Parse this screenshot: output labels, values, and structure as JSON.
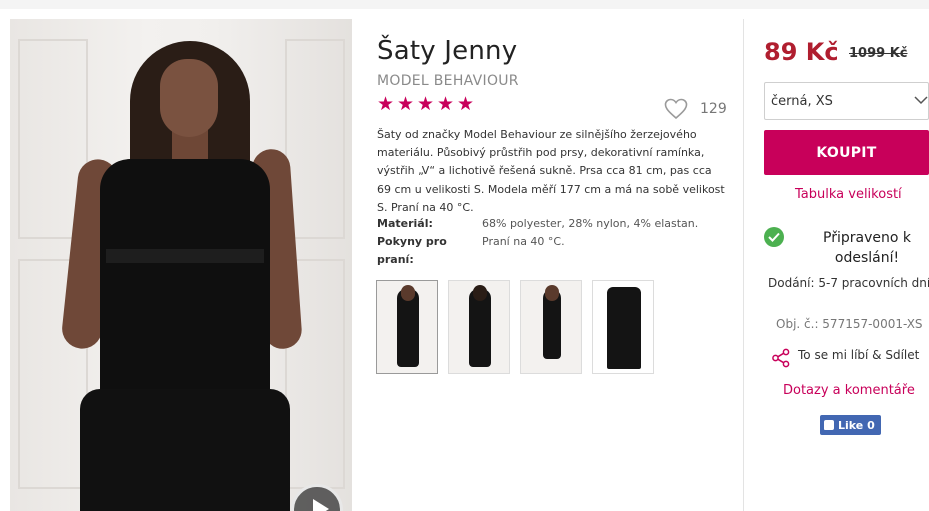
{
  "product": {
    "title": "Šaty Jenny",
    "brand": "MODEL BEHAVIOUR",
    "rating_stars": 5,
    "likes_count": "129",
    "description": "Šaty od značky Model Behaviour ze silnějšího žerzejového materiálu. Působivý průstřih pod prsy, dekorativní ramínka, výstřih „V“ a lichotivě řešená sukně. Prsa cca 81 cm, pas cca 69 cm u velikosti S. Modela měří 177 cm a má na sobě velikost S. Praní na 40 °C.",
    "properties": [
      {
        "key": "Materiál:",
        "value": "68% polyester, 28% nylon, 4% elastan."
      },
      {
        "key": "Pokyny pro praní:",
        "value": "Praní na 40 °C."
      }
    ],
    "thumbnails": [
      "front-view",
      "back-view",
      "full-length-view",
      "flat-view"
    ]
  },
  "purchase": {
    "price": "89 Kč",
    "old_price": "1099 Kč",
    "variant_value": "černá, XS",
    "buy_label": "KOUPIT",
    "size_chart_label": "Tabulka velikostí",
    "availability": "Připraveno k odeslání!",
    "delivery": "Dodání: 5-7 pracovních dní",
    "product_number": "Obj. č.: 577157-0001-XS",
    "share_label": "To se mi líbí & Sdílet",
    "questions_label": "Dotazy a komentáře",
    "fb_like_label": "Like 0"
  },
  "colors": {
    "accent": "#c8005a",
    "price": "#b01e2f",
    "success": "#4cb050",
    "facebook": "#4267b2"
  },
  "icons": [
    "play-icon",
    "heart-icon",
    "star-icon",
    "chevron-down-icon",
    "check-icon",
    "share-icon",
    "thumbs-up-icon"
  ]
}
